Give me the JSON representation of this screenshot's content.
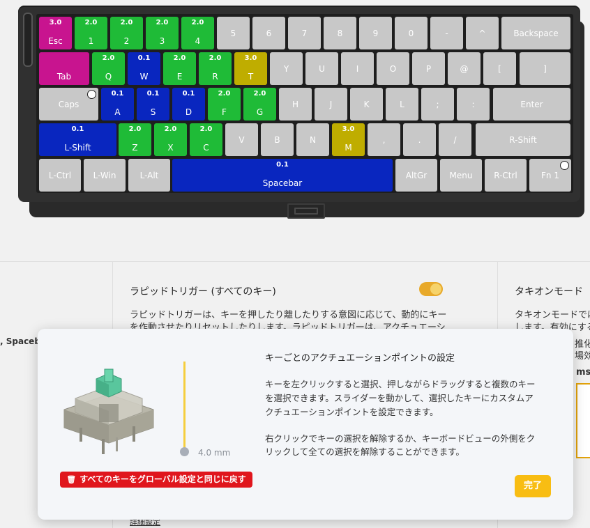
{
  "colors": {
    "gray": "#c8c8c8",
    "green": "#1fbb37",
    "blue": "#0926bf",
    "magenta": "#c8148f",
    "yellow": "#bfad00",
    "accent": "#f8bd13",
    "danger": "#e0161d"
  },
  "keyboard": {
    "rows": [
      [
        {
          "label": "Esc",
          "value": "3.0",
          "color": "magenta"
        },
        {
          "label": "1",
          "value": "2.0",
          "color": "green"
        },
        {
          "label": "2",
          "value": "2.0",
          "color": "green"
        },
        {
          "label": "3",
          "value": "2.0",
          "color": "green"
        },
        {
          "label": "4",
          "value": "2.0",
          "color": "green"
        },
        {
          "label": "5",
          "color": "gray"
        },
        {
          "label": "6",
          "color": "gray"
        },
        {
          "label": "7",
          "color": "gray"
        },
        {
          "label": "8",
          "color": "gray"
        },
        {
          "label": "9",
          "color": "gray"
        },
        {
          "label": "0",
          "color": "gray"
        },
        {
          "label": "-",
          "color": "gray"
        },
        {
          "label": "^",
          "color": "gray"
        },
        {
          "label": "Backspace",
          "color": "gray"
        }
      ],
      [
        {
          "label": "Tab",
          "color": "magenta"
        },
        {
          "label": "Q",
          "value": "2.0",
          "color": "green"
        },
        {
          "label": "W",
          "value": "0.1",
          "color": "blue"
        },
        {
          "label": "E",
          "value": "2.0",
          "color": "green"
        },
        {
          "label": "R",
          "value": "2.0",
          "color": "green"
        },
        {
          "label": "T",
          "value": "3.0",
          "color": "yellow"
        },
        {
          "label": "Y",
          "color": "gray"
        },
        {
          "label": "U",
          "color": "gray"
        },
        {
          "label": "I",
          "color": "gray"
        },
        {
          "label": "O",
          "color": "gray"
        },
        {
          "label": "P",
          "color": "gray"
        },
        {
          "label": "@",
          "color": "gray"
        },
        {
          "label": "[",
          "color": "gray"
        },
        {
          "label": "]",
          "color": "gray"
        }
      ],
      [
        {
          "label": "Caps",
          "color": "gray",
          "dot": true
        },
        {
          "label": "A",
          "value": "0.1",
          "color": "blue"
        },
        {
          "label": "S",
          "value": "0.1",
          "color": "blue"
        },
        {
          "label": "D",
          "value": "0.1",
          "color": "blue"
        },
        {
          "label": "F",
          "value": "2.0",
          "color": "green"
        },
        {
          "label": "G",
          "value": "2.0",
          "color": "green"
        },
        {
          "label": "H",
          "color": "gray"
        },
        {
          "label": "J",
          "color": "gray"
        },
        {
          "label": "K",
          "color": "gray"
        },
        {
          "label": "L",
          "color": "gray"
        },
        {
          "label": ";",
          "color": "gray"
        },
        {
          "label": ":",
          "color": "gray"
        },
        {
          "label": "Enter",
          "color": "gray"
        }
      ],
      [
        {
          "label": "L-Shift",
          "value": "0.1",
          "color": "blue"
        },
        {
          "label": "Z",
          "value": "2.0",
          "color": "green"
        },
        {
          "label": "X",
          "value": "2.0",
          "color": "green"
        },
        {
          "label": "C",
          "value": "2.0",
          "color": "green"
        },
        {
          "label": "V",
          "color": "gray"
        },
        {
          "label": "B",
          "color": "gray"
        },
        {
          "label": "N",
          "color": "gray"
        },
        {
          "label": "M",
          "value": "3.0",
          "color": "yellow"
        },
        {
          "label": ",",
          "color": "gray"
        },
        {
          "label": ".",
          "color": "gray"
        },
        {
          "label": "/",
          "color": "gray"
        },
        {
          "label": "R-Shift",
          "color": "gray"
        }
      ],
      [
        {
          "label": "L-Ctrl",
          "color": "gray"
        },
        {
          "label": "L-Win",
          "color": "gray"
        },
        {
          "label": "L-Alt",
          "color": "gray"
        },
        {
          "label": "Spacebar",
          "value": "0.1",
          "color": "blue"
        },
        {
          "label": "AltGr",
          "color": "gray"
        },
        {
          "label": "Menu",
          "color": "gray"
        },
        {
          "label": "R-Ctrl",
          "color": "gray"
        },
        {
          "label": "Fn 1",
          "color": "gray",
          "dot": true
        }
      ]
    ]
  },
  "background": {
    "left_fragment": ", Spaceba",
    "rapid_trigger": {
      "title": "ラピッドトリガー (すべてのキー)",
      "line1": "ラピッドトリガーは、キーを押したり離したりする意図に応じて、動的にキー",
      "line2": "を作動させたりリセットしたりします。ラピッドトリガーは、アクチュエーシ",
      "toggle_on": true,
      "link": "詳細設定"
    },
    "tachyon": {
      "title": "タキオンモード",
      "line1": "タキオンモードでは",
      "line2": "します。有効にする",
      "line3": "推化す",
      "line4": "場効",
      "unit": "ms"
    }
  },
  "modal": {
    "title": "キーごとのアクチュエーションポイントの設定",
    "para1_line1": "キーを左クリックすると選択、押しながらドラッグすると複数のキー",
    "para1_line2": "を選択できます。スライダーを動かして、選択したキーにカスタムア",
    "para1_line3": "クチュエーションポイントを設定できます。",
    "para2_line1": "右クリックでキーの選択を解除するか、キーボードビューの外側をク",
    "para2_line2": "リックして全ての選択を解除することができます。",
    "slider_value": "4.0 mm",
    "slider_level": 1.0,
    "reset_label": "すべてのキーをグローバル設定と同じに戻す",
    "reset_icon": "trash-icon",
    "done_label": "完了"
  }
}
